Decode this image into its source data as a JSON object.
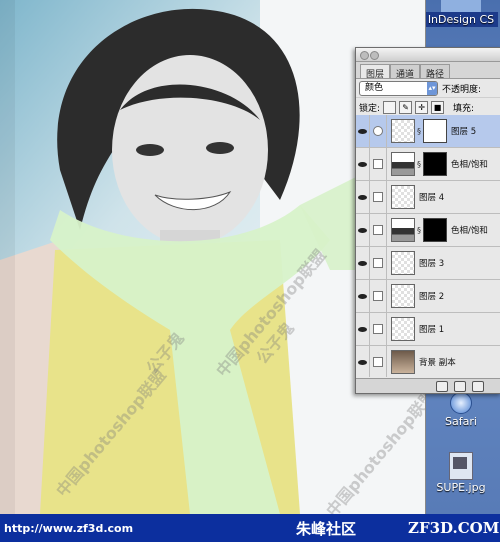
{
  "desktop": {
    "icons": [
      {
        "name": "InDesign CS"
      },
      {
        "name": "Safari"
      },
      {
        "name": "SUPE.jpg"
      }
    ]
  },
  "palette": {
    "tabs": [
      "图层",
      "通道",
      "路径"
    ],
    "blend_mode": "颜色",
    "opacity_label": "不透明度:",
    "lock_label": "锁定:",
    "fill_label": "填充:",
    "layers": [
      {
        "name": "图层 5",
        "thumb": "transparent",
        "mask": "white",
        "selected": true,
        "link_icon": "circle"
      },
      {
        "name": "色相/饱和",
        "thumb": "adj",
        "mask": "black"
      },
      {
        "name": "图层 4",
        "thumb": "transparent",
        "mask": ""
      },
      {
        "name": "色相/饱和",
        "thumb": "adj",
        "mask": "black"
      },
      {
        "name": "图层 3",
        "thumb": "transparent",
        "mask": ""
      },
      {
        "name": "图层 2",
        "thumb": "transparent",
        "mask": ""
      },
      {
        "name": "图层 1",
        "thumb": "transparent",
        "mask": ""
      },
      {
        "name": "背景 副本",
        "thumb": "photo",
        "mask": ""
      }
    ]
  },
  "watermarks": [
    "中国photoshop联盟",
    "公子鬼",
    "中国photoshop联盟",
    "公子鬼",
    "中国photoshop联盟"
  ],
  "banner": {
    "url": "http://www.zf3d.com",
    "brand": "朱峰社区",
    "domain": "ZF3D.COM"
  },
  "colors": {
    "banner_bg": "#0c2f9e",
    "selected_layer": "#b6c9ec",
    "shirt_yellow": "#e8e38a",
    "scarf_green": "#d7f2c9"
  }
}
